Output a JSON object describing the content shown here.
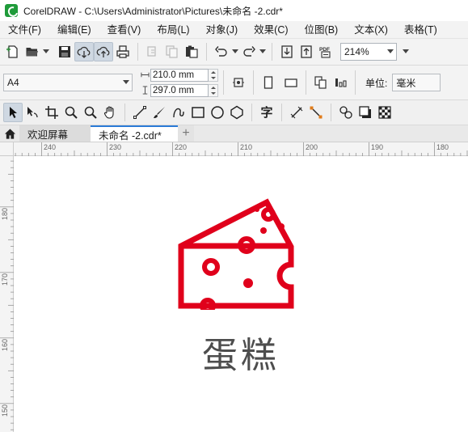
{
  "window": {
    "title": "CorelDRAW - C:\\Users\\Administrator\\Pictures\\未命名 -2.cdr*"
  },
  "menu": {
    "items": [
      {
        "label": "文件(F)"
      },
      {
        "label": "编辑(E)"
      },
      {
        "label": "查看(V)"
      },
      {
        "label": "布局(L)"
      },
      {
        "label": "对象(J)"
      },
      {
        "label": "效果(C)"
      },
      {
        "label": "位图(B)"
      },
      {
        "label": "文本(X)"
      },
      {
        "label": "表格(T)"
      }
    ]
  },
  "standard_toolbar": {
    "icons": [
      "new-document-icon",
      "open-folder-icon",
      "save-icon",
      "cloud-download-icon",
      "cloud-upload-icon",
      "print-icon",
      "cut-icon",
      "copy-icon",
      "paste-icon",
      "undo-icon",
      "redo-icon",
      "import-icon",
      "export-icon",
      "pdf-icon"
    ],
    "pdf_label": "PDF",
    "zoom_value": "214%"
  },
  "property_bar": {
    "page_size": "A4",
    "width": "210.0 mm",
    "height": "297.0 mm",
    "unit_label": "单位:",
    "unit_value": "毫米"
  },
  "toolbox": {
    "icons": [
      "pick-tool-icon",
      "shape-tool-icon",
      "crop-tool-icon",
      "zoom-tool-icon",
      "zoom-out-tool-icon",
      "pan-tool-icon",
      "freehand-tool-icon",
      "artistic-media-tool-icon",
      "curve-tool-icon",
      "rectangle-tool-icon",
      "ellipse-tool-icon",
      "polygon-tool-icon",
      "text-tool-icon",
      "parallel-dimension-icon",
      "connector-tool-icon",
      "blend-tool-icon",
      "drop-shadow-icon",
      "transparency-tool-icon"
    ],
    "text_tool_glyph": "字"
  },
  "tabs": {
    "welcome": "欢迎屏幕",
    "document": "未命名 -2.cdr*",
    "add": "+"
  },
  "rulers": {
    "horizontal_labels": [
      "240",
      "230",
      "220",
      "210",
      "200",
      "190",
      "180"
    ],
    "vertical_labels": [
      "180",
      "170",
      "160",
      "150"
    ]
  },
  "artwork": {
    "text": "蛋糕",
    "icon": "cheese-icon",
    "icon_color": "#e0001b",
    "text_color": "#4d4d4d"
  },
  "colors": {
    "accent": "#2b7bd6",
    "chrome": "#f3f3f3"
  }
}
